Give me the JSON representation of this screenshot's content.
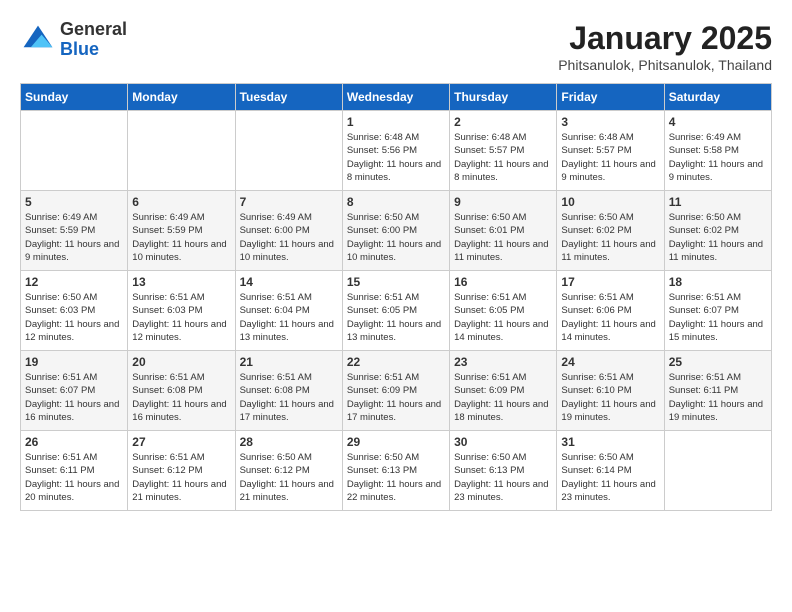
{
  "header": {
    "logo": {
      "line1": "General",
      "line2": "Blue"
    },
    "title": "January 2025",
    "subtitle": "Phitsanulok, Phitsanulok, Thailand"
  },
  "weekdays": [
    "Sunday",
    "Monday",
    "Tuesday",
    "Wednesday",
    "Thursday",
    "Friday",
    "Saturday"
  ],
  "weeks": [
    [
      {
        "day": "",
        "sunrise": "",
        "sunset": "",
        "daylight": ""
      },
      {
        "day": "",
        "sunrise": "",
        "sunset": "",
        "daylight": ""
      },
      {
        "day": "",
        "sunrise": "",
        "sunset": "",
        "daylight": ""
      },
      {
        "day": "1",
        "sunrise": "Sunrise: 6:48 AM",
        "sunset": "Sunset: 5:56 PM",
        "daylight": "Daylight: 11 hours and 8 minutes."
      },
      {
        "day": "2",
        "sunrise": "Sunrise: 6:48 AM",
        "sunset": "Sunset: 5:57 PM",
        "daylight": "Daylight: 11 hours and 8 minutes."
      },
      {
        "day": "3",
        "sunrise": "Sunrise: 6:48 AM",
        "sunset": "Sunset: 5:57 PM",
        "daylight": "Daylight: 11 hours and 9 minutes."
      },
      {
        "day": "4",
        "sunrise": "Sunrise: 6:49 AM",
        "sunset": "Sunset: 5:58 PM",
        "daylight": "Daylight: 11 hours and 9 minutes."
      }
    ],
    [
      {
        "day": "5",
        "sunrise": "Sunrise: 6:49 AM",
        "sunset": "Sunset: 5:59 PM",
        "daylight": "Daylight: 11 hours and 9 minutes."
      },
      {
        "day": "6",
        "sunrise": "Sunrise: 6:49 AM",
        "sunset": "Sunset: 5:59 PM",
        "daylight": "Daylight: 11 hours and 10 minutes."
      },
      {
        "day": "7",
        "sunrise": "Sunrise: 6:49 AM",
        "sunset": "Sunset: 6:00 PM",
        "daylight": "Daylight: 11 hours and 10 minutes."
      },
      {
        "day": "8",
        "sunrise": "Sunrise: 6:50 AM",
        "sunset": "Sunset: 6:00 PM",
        "daylight": "Daylight: 11 hours and 10 minutes."
      },
      {
        "day": "9",
        "sunrise": "Sunrise: 6:50 AM",
        "sunset": "Sunset: 6:01 PM",
        "daylight": "Daylight: 11 hours and 11 minutes."
      },
      {
        "day": "10",
        "sunrise": "Sunrise: 6:50 AM",
        "sunset": "Sunset: 6:02 PM",
        "daylight": "Daylight: 11 hours and 11 minutes."
      },
      {
        "day": "11",
        "sunrise": "Sunrise: 6:50 AM",
        "sunset": "Sunset: 6:02 PM",
        "daylight": "Daylight: 11 hours and 11 minutes."
      }
    ],
    [
      {
        "day": "12",
        "sunrise": "Sunrise: 6:50 AM",
        "sunset": "Sunset: 6:03 PM",
        "daylight": "Daylight: 11 hours and 12 minutes."
      },
      {
        "day": "13",
        "sunrise": "Sunrise: 6:51 AM",
        "sunset": "Sunset: 6:03 PM",
        "daylight": "Daylight: 11 hours and 12 minutes."
      },
      {
        "day": "14",
        "sunrise": "Sunrise: 6:51 AM",
        "sunset": "Sunset: 6:04 PM",
        "daylight": "Daylight: 11 hours and 13 minutes."
      },
      {
        "day": "15",
        "sunrise": "Sunrise: 6:51 AM",
        "sunset": "Sunset: 6:05 PM",
        "daylight": "Daylight: 11 hours and 13 minutes."
      },
      {
        "day": "16",
        "sunrise": "Sunrise: 6:51 AM",
        "sunset": "Sunset: 6:05 PM",
        "daylight": "Daylight: 11 hours and 14 minutes."
      },
      {
        "day": "17",
        "sunrise": "Sunrise: 6:51 AM",
        "sunset": "Sunset: 6:06 PM",
        "daylight": "Daylight: 11 hours and 14 minutes."
      },
      {
        "day": "18",
        "sunrise": "Sunrise: 6:51 AM",
        "sunset": "Sunset: 6:07 PM",
        "daylight": "Daylight: 11 hours and 15 minutes."
      }
    ],
    [
      {
        "day": "19",
        "sunrise": "Sunrise: 6:51 AM",
        "sunset": "Sunset: 6:07 PM",
        "daylight": "Daylight: 11 hours and 16 minutes."
      },
      {
        "day": "20",
        "sunrise": "Sunrise: 6:51 AM",
        "sunset": "Sunset: 6:08 PM",
        "daylight": "Daylight: 11 hours and 16 minutes."
      },
      {
        "day": "21",
        "sunrise": "Sunrise: 6:51 AM",
        "sunset": "Sunset: 6:08 PM",
        "daylight": "Daylight: 11 hours and 17 minutes."
      },
      {
        "day": "22",
        "sunrise": "Sunrise: 6:51 AM",
        "sunset": "Sunset: 6:09 PM",
        "daylight": "Daylight: 11 hours and 17 minutes."
      },
      {
        "day": "23",
        "sunrise": "Sunrise: 6:51 AM",
        "sunset": "Sunset: 6:09 PM",
        "daylight": "Daylight: 11 hours and 18 minutes."
      },
      {
        "day": "24",
        "sunrise": "Sunrise: 6:51 AM",
        "sunset": "Sunset: 6:10 PM",
        "daylight": "Daylight: 11 hours and 19 minutes."
      },
      {
        "day": "25",
        "sunrise": "Sunrise: 6:51 AM",
        "sunset": "Sunset: 6:11 PM",
        "daylight": "Daylight: 11 hours and 19 minutes."
      }
    ],
    [
      {
        "day": "26",
        "sunrise": "Sunrise: 6:51 AM",
        "sunset": "Sunset: 6:11 PM",
        "daylight": "Daylight: 11 hours and 20 minutes."
      },
      {
        "day": "27",
        "sunrise": "Sunrise: 6:51 AM",
        "sunset": "Sunset: 6:12 PM",
        "daylight": "Daylight: 11 hours and 21 minutes."
      },
      {
        "day": "28",
        "sunrise": "Sunrise: 6:50 AM",
        "sunset": "Sunset: 6:12 PM",
        "daylight": "Daylight: 11 hours and 21 minutes."
      },
      {
        "day": "29",
        "sunrise": "Sunrise: 6:50 AM",
        "sunset": "Sunset: 6:13 PM",
        "daylight": "Daylight: 11 hours and 22 minutes."
      },
      {
        "day": "30",
        "sunrise": "Sunrise: 6:50 AM",
        "sunset": "Sunset: 6:13 PM",
        "daylight": "Daylight: 11 hours and 23 minutes."
      },
      {
        "day": "31",
        "sunrise": "Sunrise: 6:50 AM",
        "sunset": "Sunset: 6:14 PM",
        "daylight": "Daylight: 11 hours and 23 minutes."
      },
      {
        "day": "",
        "sunrise": "",
        "sunset": "",
        "daylight": ""
      }
    ]
  ]
}
